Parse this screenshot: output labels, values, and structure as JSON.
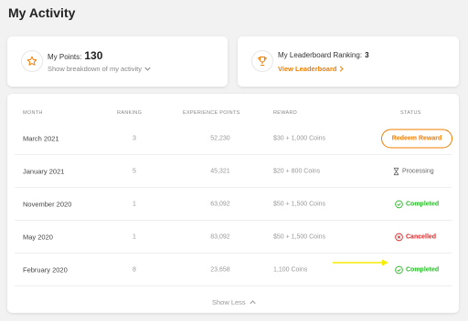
{
  "page_title": "My Activity",
  "points": {
    "label": "My Points:",
    "value": "130",
    "breakdown_link": "Show breakdown of my activity"
  },
  "leaderboard": {
    "label": "My Leaderboard Ranking:",
    "value": "3",
    "link": "View Leaderboard"
  },
  "table": {
    "headers": [
      "MONTH",
      "RANKING",
      "EXPERIENCE POINTS",
      "REWARD",
      "STATUS"
    ],
    "rows": [
      {
        "month": "March 2021",
        "ranking": "3",
        "xp": "52,230",
        "reward": "$30 + 1,000 Coins",
        "status": "Redeem Reward",
        "status_type": "button"
      },
      {
        "month": "January 2021",
        "ranking": "5",
        "xp": "45,321",
        "reward": "$20 + 800 Coins",
        "status": "Processing",
        "status_type": "processing"
      },
      {
        "month": "November 2020",
        "ranking": "1",
        "xp": "63,092",
        "reward": "$50 + 1,500 Coins",
        "status": "Completed",
        "status_type": "completed"
      },
      {
        "month": "May 2020",
        "ranking": "1",
        "xp": "83,092",
        "reward": "$50 + 1,500 Coins",
        "status": "Cancelled",
        "status_type": "cancelled"
      },
      {
        "month": "February 2020",
        "ranking": "8",
        "xp": "23,658",
        "reward": "1,100 Coins",
        "status": "Completed",
        "status_type": "completed"
      }
    ]
  },
  "show_less": "Show Less",
  "icons": {
    "points": "star-icon",
    "leaderboard": "trophy-icon",
    "breakdown": "chevron-down-icon",
    "view_leaderboard": "chevron-right-icon",
    "processing": "hourglass-icon",
    "completed": "check-circle-icon",
    "cancelled": "x-circle-icon",
    "show_less": "chevron-up-icon",
    "annotation": "arrow-right-annotation"
  },
  "colors": {
    "accent": "#f07d00",
    "completed": "#2eb82e",
    "cancelled": "#e02424",
    "processing": "#666666",
    "annotation": "#f5ec00"
  }
}
